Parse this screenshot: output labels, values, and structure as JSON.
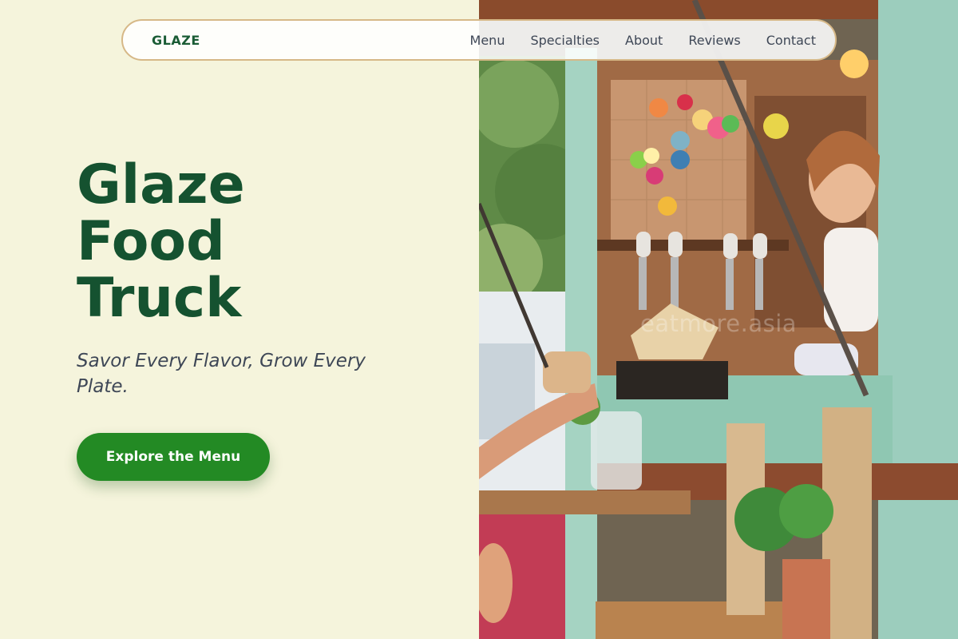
{
  "nav": {
    "brand": "GLAZE",
    "links": [
      "Menu",
      "Specialties",
      "About",
      "Reviews",
      "Contact"
    ]
  },
  "hero": {
    "title_lines": [
      "Glaze",
      "Food",
      "Truck"
    ],
    "tagline": "Savor Every Flavor, Grow Every Plate.",
    "cta_label": "Explore the Menu",
    "photo_watermark": "eatmore.asia"
  },
  "colors": {
    "page_background": "#f5f4dc",
    "brand_green": "#155230",
    "cta_green": "#238a24",
    "nav_border": "#d6b887",
    "body_text": "#3e4756"
  },
  "icons": [
    "food-truck-photo"
  ]
}
